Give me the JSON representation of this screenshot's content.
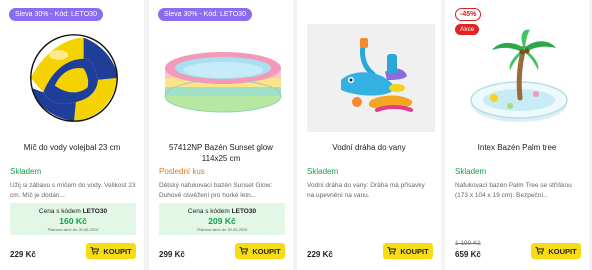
{
  "cart_icon": "shopping-cart-icon",
  "colors": {
    "badge_purple": "#8b6cf0",
    "stock_green": "#14a04a",
    "stock_out_orange": "#e07a1a",
    "promo_bg": "#e2f7e6",
    "buy_button": "#f6dc14",
    "sale_red": "#e32222"
  },
  "products": [
    {
      "badge": "Sleva 30% - Kód: LETO30",
      "title": "Míč do vody volejbal 23 cm",
      "stock": "Skladem",
      "description": "Užij si zábavu s míčem do vody. Velikost 23 cm. Míč je dodán...",
      "promo": {
        "prefix": "Cena s kódem",
        "code": "LETO30",
        "price": "160 Kč",
        "note": "Platnost akce do 30.06.2026"
      },
      "price": "229 Kč",
      "buy_label": "KOUPIT"
    },
    {
      "badge": "Sleva 30% - Kód: LETO30",
      "title": "57412NP Bazén Sunset glow 114x25 cm",
      "stock": "Poslední kus",
      "description": "Dětský nafukovací bazén Sunset Glow: Duhové osvěžení pro horké letn...",
      "promo": {
        "prefix": "Cena s kódem",
        "code": "LETO30",
        "price": "209 Kč",
        "note": "Platnost akce do 30.06.2026"
      },
      "price": "299 Kč",
      "buy_label": "KOUPIT"
    },
    {
      "title": "Vodní dráha do vany",
      "stock": "Skladem",
      "description": "Vodní dráha do vany: Dráha má přísavky na upevnění na vanu.",
      "price": "229 Kč",
      "buy_label": "KOUPIT"
    },
    {
      "discount": "-45%",
      "sale": "Akce",
      "title": "Intex Bazén Palm tree",
      "stock": "Skladem",
      "description": "Nafukovací bazén Palm Tree se stříškou (173 x 104 x 19 cm): Bezpeční...",
      "old_price": "1 199 Kč",
      "price": "659 Kč",
      "buy_label": "KOUPIT"
    }
  ]
}
